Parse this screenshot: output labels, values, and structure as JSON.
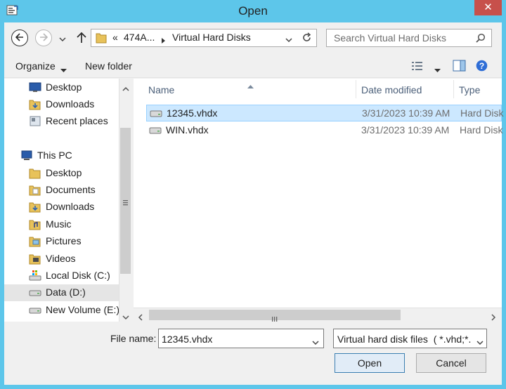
{
  "window": {
    "title": "Open",
    "close_glyph": "✕"
  },
  "navigation": {
    "back_icon": "back-arrow-icon",
    "forward_icon": "forward-arrow-icon",
    "up_icon": "up-arrow-icon"
  },
  "address_bar": {
    "overflow": "«",
    "segments": [
      "474A...",
      "Virtual Hard Disks"
    ]
  },
  "search": {
    "placeholder": "Search Virtual Hard Disks"
  },
  "toolbar": {
    "organize_label": "Organize",
    "new_folder_label": "New folder"
  },
  "nav_pane": {
    "items": [
      {
        "label": "Desktop",
        "icon": "desktop-icon"
      },
      {
        "label": "Downloads",
        "icon": "downloads-folder-icon"
      },
      {
        "label": "Recent places",
        "icon": "recent-places-icon"
      },
      {
        "label": "This PC",
        "icon": "this-pc-icon"
      },
      {
        "label": "Desktop",
        "icon": "folder-icon"
      },
      {
        "label": "Documents",
        "icon": "folder-icon"
      },
      {
        "label": "Downloads",
        "icon": "downloads-folder-icon"
      },
      {
        "label": "Music",
        "icon": "music-folder-icon"
      },
      {
        "label": "Pictures",
        "icon": "pictures-folder-icon"
      },
      {
        "label": "Videos",
        "icon": "videos-folder-icon"
      },
      {
        "label": "Local Disk (C:)",
        "icon": "system-drive-icon"
      },
      {
        "label": "Data (D:)",
        "icon": "drive-icon"
      },
      {
        "label": "New Volume (E:)",
        "icon": "drive-icon"
      }
    ],
    "selected_index": 11
  },
  "file_list": {
    "columns": [
      "Name",
      "Date modified",
      "Type"
    ],
    "rows": [
      {
        "name": "12345.vhdx",
        "date": "3/31/2023 10:39 AM",
        "type": "Hard Disk",
        "selected": true
      },
      {
        "name": "WIN.vhdx",
        "date": "3/31/2023 10:39 AM",
        "type": "Hard Disk",
        "selected": false
      }
    ]
  },
  "bottom": {
    "filename_label": "File name:",
    "filename_value": "12345.vhdx",
    "filter_value": "Virtual hard disk files  ( *.vhd;*.",
    "open_label": "Open",
    "cancel_label": "Cancel"
  },
  "colors": {
    "frame": "#5dc6ea",
    "close": "#c7504b",
    "selection": "#cce8ff"
  }
}
